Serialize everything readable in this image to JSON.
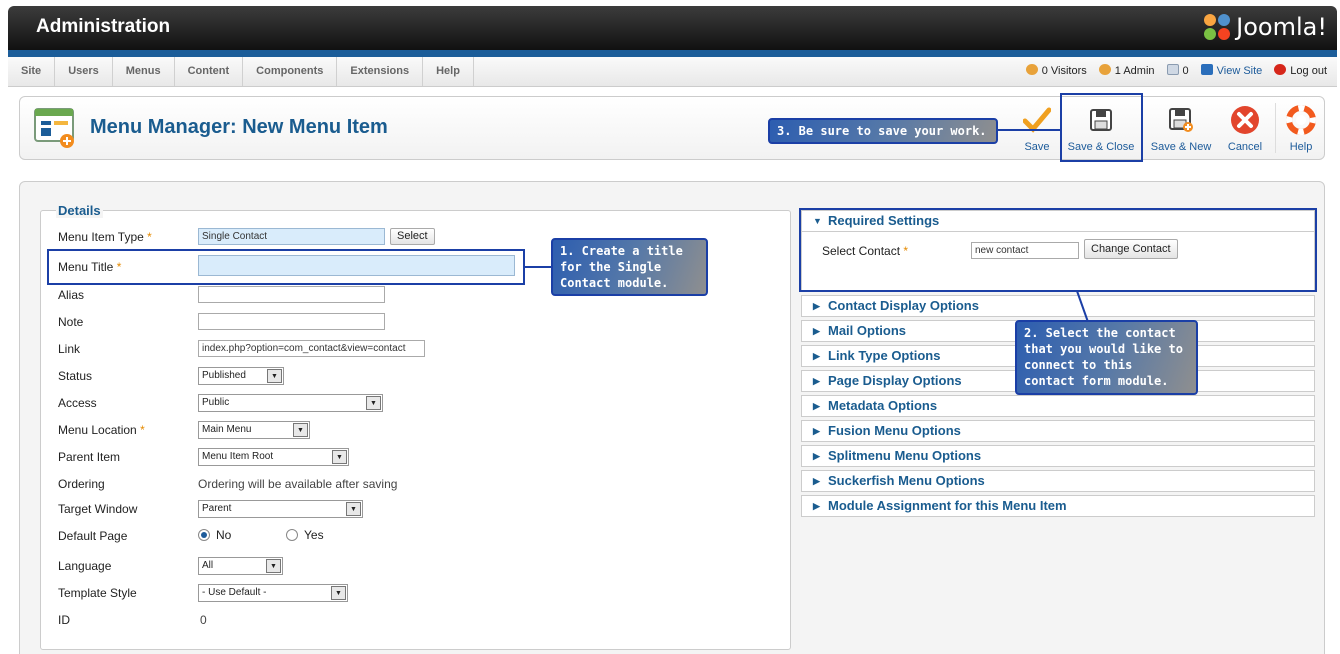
{
  "header": {
    "title": "Administration",
    "logo_text": "Joomla!"
  },
  "menubar": {
    "items": [
      {
        "label": "Site"
      },
      {
        "label": "Users"
      },
      {
        "label": "Menus"
      },
      {
        "label": "Content"
      },
      {
        "label": "Components"
      },
      {
        "label": "Extensions"
      },
      {
        "label": "Help"
      }
    ],
    "visitors": "0 Visitors",
    "admins": "1 Admin",
    "messages": "0",
    "view_site": "View Site",
    "logout": "Log out"
  },
  "toolbar": {
    "title": "Menu Manager: New Menu Item",
    "save": "Save",
    "save_close": "Save & Close",
    "save_new": "Save & New",
    "cancel": "Cancel",
    "help": "Help"
  },
  "callouts": {
    "c1": "1. Create a title for the Single Contact module.",
    "c2": "2. Select the contact that you would like to connect to this contact form module.",
    "c3": "3. Be sure to save your work."
  },
  "details": {
    "legend": "Details",
    "menu_item_type_label": "Menu Item Type",
    "menu_item_type_value": "Single Contact",
    "select_button": "Select",
    "menu_title_label": "Menu Title",
    "menu_title_value": "",
    "alias_label": "Alias",
    "note_label": "Note",
    "link_label": "Link",
    "link_value": "index.php?option=com_contact&view=contact",
    "status_label": "Status",
    "status_value": "Published",
    "access_label": "Access",
    "access_value": "Public",
    "menu_location_label": "Menu Location",
    "menu_location_value": "Main Menu",
    "parent_label": "Parent Item",
    "parent_value": "Menu Item Root",
    "ordering_label": "Ordering",
    "ordering_value": "Ordering will be available after saving",
    "target_label": "Target Window",
    "target_value": "Parent",
    "default_label": "Default Page",
    "default_no": "No",
    "default_yes": "Yes",
    "language_label": "Language",
    "language_value": "All",
    "template_label": "Template Style",
    "template_value": "- Use Default -",
    "id_label": "ID",
    "id_value": "0",
    "required_mark": "*"
  },
  "panels": {
    "required": "Required Settings",
    "select_contact_label": "Select Contact",
    "select_contact_value": "new contact",
    "change_contact": "Change Contact",
    "items": [
      "Contact Display Options",
      "Mail Options",
      "Link Type Options",
      "Page Display Options",
      "Metadata Options",
      "Fusion Menu Options",
      "Splitmenu Menu Options",
      "Suckerfish Menu Options",
      "Module Assignment for this Menu Item"
    ]
  },
  "colors": {
    "accent": "#1a5c8f",
    "bluebar": "#1c5d99",
    "callout_border": "#1b3fa6",
    "required": "#e58a00"
  }
}
